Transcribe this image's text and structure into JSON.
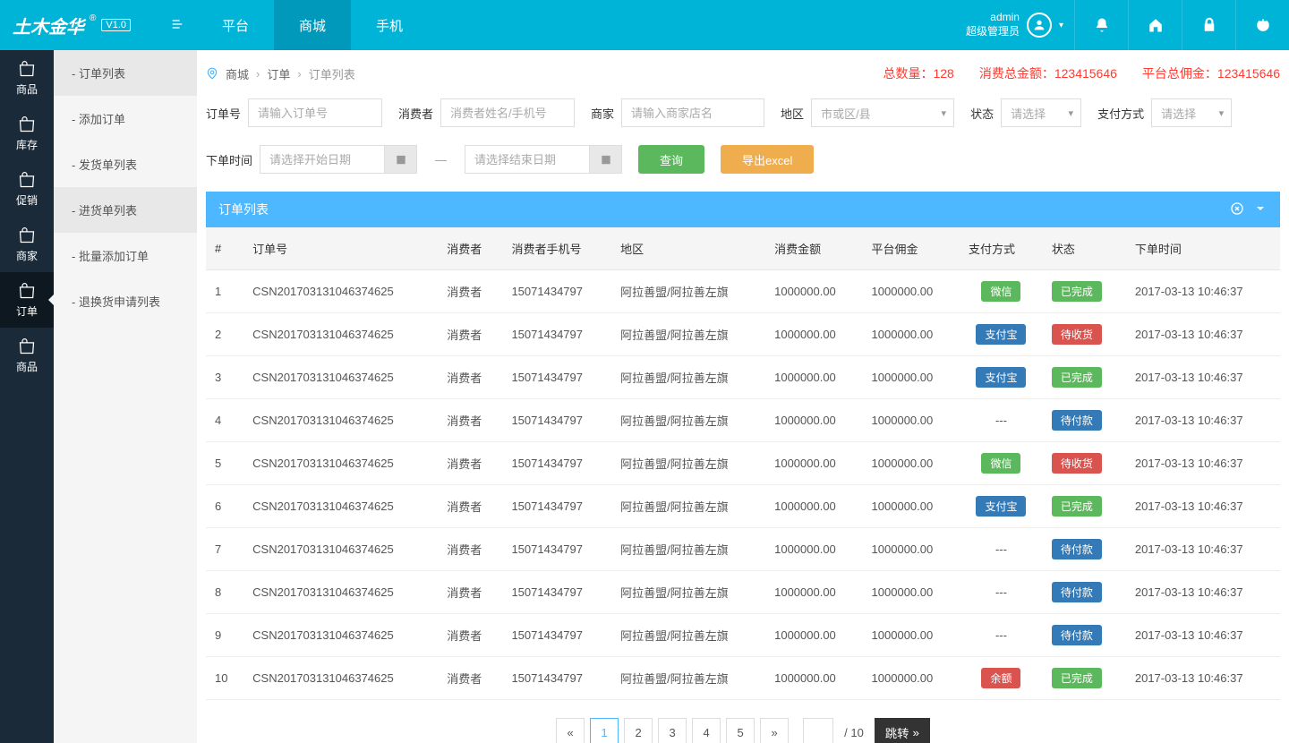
{
  "logo": {
    "text": "土木金华",
    "reg": "®",
    "version": "V1.0"
  },
  "topnav": [
    {
      "label": "平台"
    },
    {
      "label": "商城"
    },
    {
      "label": "手机"
    }
  ],
  "user": {
    "name": "admin",
    "role": "超级管理员"
  },
  "sidebar": [
    {
      "label": "商品"
    },
    {
      "label": "库存"
    },
    {
      "label": "促销"
    },
    {
      "label": "商家"
    },
    {
      "label": "订单"
    },
    {
      "label": "商品"
    }
  ],
  "submenu": [
    {
      "label": "- 订单列表"
    },
    {
      "label": "- 添加订单"
    },
    {
      "label": "- 发货单列表"
    },
    {
      "label": "- 进货单列表"
    },
    {
      "label": "- 批量添加订单"
    },
    {
      "label": "- 退换货申请列表"
    }
  ],
  "breadcrumb": {
    "a": "商城",
    "b": "订单",
    "c": "订单列表"
  },
  "stats": {
    "count": "总数量：128",
    "total": "消费总金额：123415646",
    "commission": "平台总佣金：123415646"
  },
  "filters": {
    "orderNo": {
      "label": "订单号",
      "placeholder": "请输入订单号"
    },
    "consumer": {
      "label": "消费者",
      "placeholder": "消费者姓名/手机号"
    },
    "merchant": {
      "label": "商家",
      "placeholder": "请输入商家店名"
    },
    "region": {
      "label": "地区",
      "placeholder": "市或区/县"
    },
    "status": {
      "label": "状态",
      "placeholder": "请选择"
    },
    "payment": {
      "label": "支付方式",
      "placeholder": "请选择"
    },
    "time": {
      "label": "下单时间",
      "startPlaceholder": "请选择开始日期",
      "endPlaceholder": "请选择结束日期"
    },
    "searchBtn": "查询",
    "exportBtn": "导出excel"
  },
  "panel": {
    "title": "订单列表"
  },
  "table": {
    "headers": [
      "#",
      "订单号",
      "消费者",
      "消费者手机号",
      "地区",
      "消费金额",
      "平台佣金",
      "支付方式",
      "状态",
      "下单时间"
    ],
    "rows": [
      {
        "idx": "1",
        "no": "CSN201703131046374625",
        "consumer": "消费者",
        "phone": "15071434797",
        "region": "阿拉善盟/阿拉善左旗",
        "amount": "1000000.00",
        "commission": "1000000.00",
        "pay": "微信",
        "payColor": "green",
        "status": "已完成",
        "statusColor": "green",
        "time": "2017-03-13 10:46:37"
      },
      {
        "idx": "2",
        "no": "CSN201703131046374625",
        "consumer": "消费者",
        "phone": "15071434797",
        "region": "阿拉善盟/阿拉善左旗",
        "amount": "1000000.00",
        "commission": "1000000.00",
        "pay": "支付宝",
        "payColor": "blue",
        "status": "待收货",
        "statusColor": "red",
        "time": "2017-03-13 10:46:37"
      },
      {
        "idx": "3",
        "no": "CSN201703131046374625",
        "consumer": "消费者",
        "phone": "15071434797",
        "region": "阿拉善盟/阿拉善左旗",
        "amount": "1000000.00",
        "commission": "1000000.00",
        "pay": "支付宝",
        "payColor": "blue",
        "status": "已完成",
        "statusColor": "green",
        "time": "2017-03-13 10:46:37"
      },
      {
        "idx": "4",
        "no": "CSN201703131046374625",
        "consumer": "消费者",
        "phone": "15071434797",
        "region": "阿拉善盟/阿拉善左旗",
        "amount": "1000000.00",
        "commission": "1000000.00",
        "pay": "---",
        "payColor": "none",
        "status": "待付款",
        "statusColor": "blue",
        "time": "2017-03-13 10:46:37"
      },
      {
        "idx": "5",
        "no": "CSN201703131046374625",
        "consumer": "消费者",
        "phone": "15071434797",
        "region": "阿拉善盟/阿拉善左旗",
        "amount": "1000000.00",
        "commission": "1000000.00",
        "pay": "微信",
        "payColor": "green",
        "status": "待收货",
        "statusColor": "red",
        "time": "2017-03-13 10:46:37"
      },
      {
        "idx": "6",
        "no": "CSN201703131046374625",
        "consumer": "消费者",
        "phone": "15071434797",
        "region": "阿拉善盟/阿拉善左旗",
        "amount": "1000000.00",
        "commission": "1000000.00",
        "pay": "支付宝",
        "payColor": "blue",
        "status": "已完成",
        "statusColor": "green",
        "time": "2017-03-13 10:46:37"
      },
      {
        "idx": "7",
        "no": "CSN201703131046374625",
        "consumer": "消费者",
        "phone": "15071434797",
        "region": "阿拉善盟/阿拉善左旗",
        "amount": "1000000.00",
        "commission": "1000000.00",
        "pay": "---",
        "payColor": "none",
        "status": "待付款",
        "statusColor": "blue",
        "time": "2017-03-13 10:46:37"
      },
      {
        "idx": "8",
        "no": "CSN201703131046374625",
        "consumer": "消费者",
        "phone": "15071434797",
        "region": "阿拉善盟/阿拉善左旗",
        "amount": "1000000.00",
        "commission": "1000000.00",
        "pay": "---",
        "payColor": "none",
        "status": "待付款",
        "statusColor": "blue",
        "time": "2017-03-13 10:46:37"
      },
      {
        "idx": "9",
        "no": "CSN201703131046374625",
        "consumer": "消费者",
        "phone": "15071434797",
        "region": "阿拉善盟/阿拉善左旗",
        "amount": "1000000.00",
        "commission": "1000000.00",
        "pay": "---",
        "payColor": "none",
        "status": "待付款",
        "statusColor": "blue",
        "time": "2017-03-13 10:46:37"
      },
      {
        "idx": "10",
        "no": "CSN201703131046374625",
        "consumer": "消费者",
        "phone": "15071434797",
        "region": "阿拉善盟/阿拉善左旗",
        "amount": "1000000.00",
        "commission": "1000000.00",
        "pay": "余额",
        "payColor": "red",
        "status": "已完成",
        "statusColor": "green",
        "time": "2017-03-13 10:46:37"
      }
    ]
  },
  "pagination": {
    "pages": [
      "1",
      "2",
      "3",
      "4",
      "5"
    ],
    "total": "/ 10",
    "jump": "跳转"
  }
}
